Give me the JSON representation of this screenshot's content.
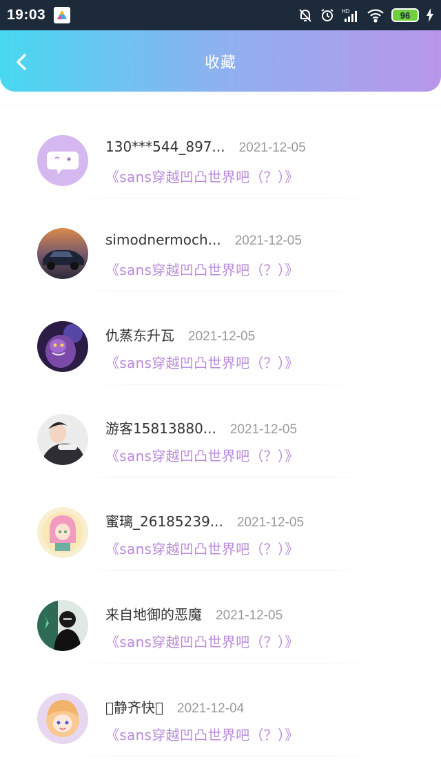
{
  "status_bar": {
    "time": "19:03",
    "network_label": "HD",
    "battery_level": "96",
    "icons": [
      "app-launcher-icon",
      "mute-bell-icon",
      "alarm-icon",
      "signal-icon",
      "wifi-icon",
      "battery-icon",
      "charging-icon"
    ]
  },
  "header": {
    "title": "收藏",
    "back_icon": "chevron-left-icon",
    "gradient": [
      "#48d8f0",
      "#b896ea"
    ]
  },
  "colors": {
    "accent": "#b88ad9",
    "text_primary": "#333333",
    "text_secondary": "#999999"
  },
  "items": [
    {
      "username": "130***544_897...",
      "date": "2021-12-05",
      "post_title": "《sans穿越凹凸世界吧（？）》",
      "avatar": "default-chat-avatar"
    },
    {
      "username": "simodnermoch...",
      "date": "2021-12-05",
      "post_title": "《sans穿越凹凸世界吧（？）》",
      "avatar": "car-photo-avatar"
    },
    {
      "username": "仇蒸东升瓦",
      "date": "2021-12-05",
      "post_title": "《sans穿越凹凸世界吧（？）》",
      "avatar": "purple-character-avatar"
    },
    {
      "username": "游客15813880...",
      "date": "2021-12-05",
      "post_title": "《sans穿越凹凸世界吧（？）》",
      "avatar": "person-photo-avatar"
    },
    {
      "username": "蜜璃_26185239...",
      "date": "2021-12-05",
      "post_title": "《sans穿越凹凸世界吧（？）》",
      "avatar": "anime-girl-avatar"
    },
    {
      "username": "来自地御的恶魔",
      "date": "2021-12-05",
      "post_title": "《sans穿越凹凸世界吧（？）》",
      "avatar": "dark-figure-avatar"
    },
    {
      "username": "\u0000静齐快\u0000",
      "date": "2021-12-04",
      "post_title": "《sans穿越凹凸世界吧（？）》",
      "avatar": "cartoon-girl-avatar"
    }
  ]
}
